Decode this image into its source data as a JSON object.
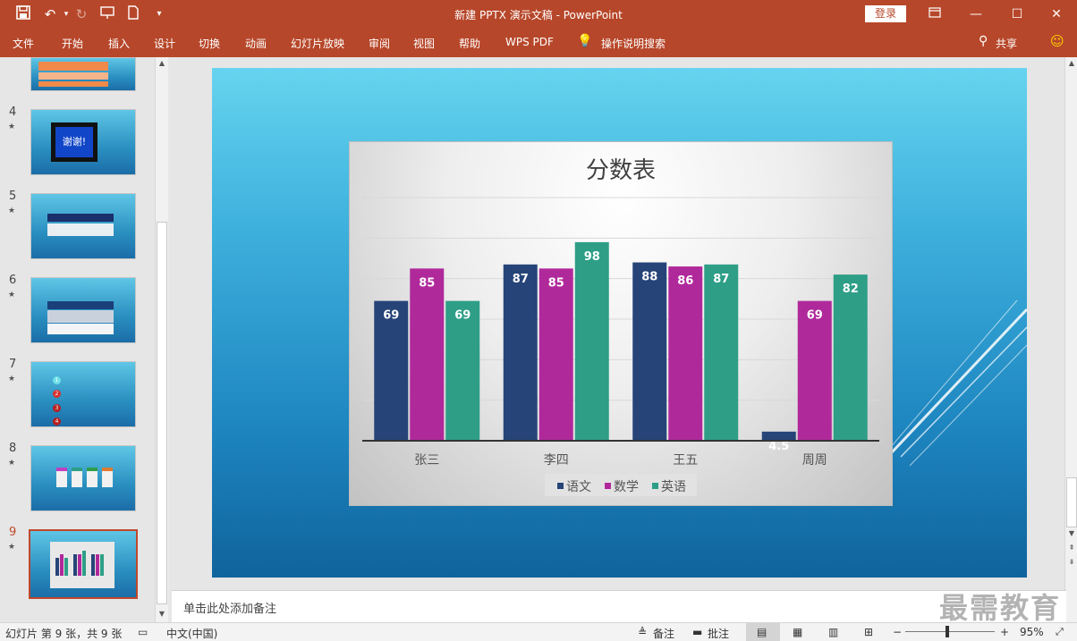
{
  "app": {
    "title": "新建 PPTX 演示文稿  -  PowerPoint",
    "login_label": "登录"
  },
  "ribbon_tabs": [
    "文件",
    "开始",
    "插入",
    "设计",
    "切换",
    "动画",
    "幻灯片放映",
    "审阅",
    "视图",
    "帮助",
    "WPS PDF"
  ],
  "tell_me": "操作说明搜索",
  "share_label": "共享",
  "thumbnails": [
    {
      "num": "4",
      "star": "★",
      "text": "谢谢!"
    },
    {
      "num": "5",
      "star": "★"
    },
    {
      "num": "6",
      "star": "★"
    },
    {
      "num": "7",
      "star": "★",
      "items": [
        "1",
        "2",
        "3",
        "4"
      ]
    },
    {
      "num": "8",
      "star": "★"
    },
    {
      "num": "9",
      "star": "★"
    }
  ],
  "notes_placeholder": "单击此处添加备注",
  "status": {
    "slide_info": "幻灯片 第 9 张，共 9 张",
    "language": "中文(中国)",
    "notes_label": "备注",
    "comments_label": "批注",
    "zoom": "95%"
  },
  "watermark": "最需教育",
  "colors": {
    "accent": "#b7472a",
    "series": [
      "#264478",
      "#b0299b",
      "#2e9e87"
    ]
  },
  "chart_data": {
    "type": "bar",
    "title": "分数表",
    "categories": [
      "张三",
      "李四",
      "王五",
      "周周"
    ],
    "series": [
      {
        "name": "语文",
        "values": [
          69,
          87,
          88,
          4.5
        ]
      },
      {
        "name": "数学",
        "values": [
          85,
          85,
          86,
          69
        ]
      },
      {
        "name": "英语",
        "values": [
          69,
          98,
          87,
          82
        ]
      }
    ],
    "ylim": [
      0,
      120
    ],
    "grid": true,
    "legend": "bottom",
    "data_labels": true
  }
}
